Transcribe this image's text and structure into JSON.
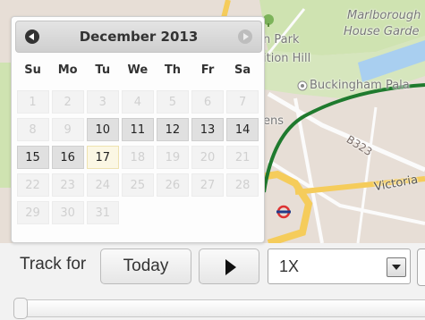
{
  "map": {
    "labels": {
      "marlborough": "Marlborough",
      "house_garden": "House Garde",
      "park": "n Park",
      "hill": "ition Hill",
      "buckingham": "Buckingham Pala",
      "ens": "ens",
      "b323": "B323",
      "victoria": "Victoria"
    },
    "colors": {
      "park": "#cfe3b1",
      "water": "#a9cff0",
      "land": "#e7ded6",
      "major_road": "#f5cc5b",
      "route": "#1f7a2e"
    },
    "icons": [
      "tree-icon",
      "place-marker-icon",
      "underground-station-icon"
    ]
  },
  "calendar": {
    "title": "December 2013",
    "prev_icon": "prev-month-icon",
    "next_icon": "next-month-icon",
    "weekdays": [
      "Su",
      "Mo",
      "Tu",
      "We",
      "Th",
      "Fr",
      "Sa"
    ],
    "weeks": [
      [
        {
          "d": "1",
          "s": "disabled"
        },
        {
          "d": "2",
          "s": "disabled"
        },
        {
          "d": "3",
          "s": "disabled"
        },
        {
          "d": "4",
          "s": "disabled"
        },
        {
          "d": "5",
          "s": "disabled"
        },
        {
          "d": "6",
          "s": "disabled"
        },
        {
          "d": "7",
          "s": "disabled"
        }
      ],
      [
        {
          "d": "8",
          "s": "disabled"
        },
        {
          "d": "9",
          "s": "disabled"
        },
        {
          "d": "10",
          "s": "active"
        },
        {
          "d": "11",
          "s": "active"
        },
        {
          "d": "12",
          "s": "active"
        },
        {
          "d": "13",
          "s": "active"
        },
        {
          "d": "14",
          "s": "active"
        }
      ],
      [
        {
          "d": "15",
          "s": "active"
        },
        {
          "d": "16",
          "s": "active"
        },
        {
          "d": "17",
          "s": "today"
        },
        {
          "d": "18",
          "s": "disabled"
        },
        {
          "d": "19",
          "s": "disabled"
        },
        {
          "d": "20",
          "s": "disabled"
        },
        {
          "d": "21",
          "s": "disabled"
        }
      ],
      [
        {
          "d": "22",
          "s": "disabled"
        },
        {
          "d": "23",
          "s": "disabled"
        },
        {
          "d": "24",
          "s": "disabled"
        },
        {
          "d": "25",
          "s": "disabled"
        },
        {
          "d": "26",
          "s": "disabled"
        },
        {
          "d": "27",
          "s": "disabled"
        },
        {
          "d": "28",
          "s": "disabled"
        }
      ],
      [
        {
          "d": "29",
          "s": "disabled"
        },
        {
          "d": "30",
          "s": "disabled"
        },
        {
          "d": "31",
          "s": "disabled"
        },
        {
          "d": "",
          "s": "empty"
        },
        {
          "d": "",
          "s": "empty"
        },
        {
          "d": "",
          "s": "empty"
        },
        {
          "d": "",
          "s": "empty"
        }
      ]
    ]
  },
  "controls": {
    "track_label": "Track for",
    "today_label": "Today",
    "play_icon": "play-icon",
    "speed_value": "1X",
    "speed_icon": "dropdown-arrow-icon",
    "slider_position": 0
  }
}
